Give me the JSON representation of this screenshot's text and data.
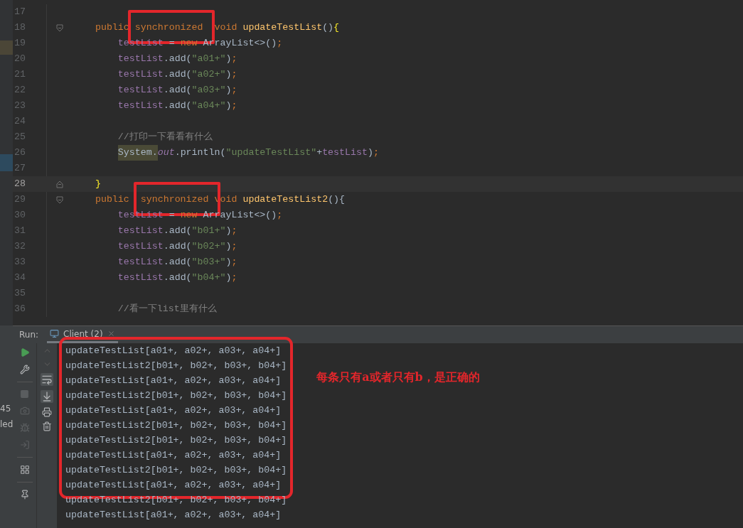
{
  "editor": {
    "lines": [
      {
        "number": "17",
        "kind": "plain",
        "current": false
      },
      {
        "number": "18",
        "kind": "fold-start",
        "current": false,
        "tokens": [
          {
            "kind": "keyword",
            "text": "    public "
          },
          {
            "kind": "keyword",
            "text": "synchronized",
            "boxed": true
          },
          {
            "kind": "keyword",
            "text": "  void "
          },
          {
            "kind": "method",
            "text": "updateTestList"
          },
          {
            "kind": "plain",
            "text": "()"
          },
          {
            "kind": "brace",
            "text": "{"
          }
        ]
      },
      {
        "number": "19",
        "kind": "plain",
        "current": false,
        "tokens": [
          {
            "kind": "field",
            "text": "        testList"
          },
          {
            "kind": "plain",
            "text": " = "
          },
          {
            "kind": "keyword",
            "text": "new "
          },
          {
            "kind": "plain",
            "text": "ArrayList<>()"
          },
          {
            "kind": "keyword",
            "text": ";"
          }
        ]
      },
      {
        "number": "20",
        "kind": "plain",
        "current": false,
        "tokens": [
          {
            "kind": "field",
            "text": "        testList"
          },
          {
            "kind": "plain",
            "text": ".add("
          },
          {
            "kind": "string",
            "text": "\"a01+\""
          },
          {
            "kind": "plain",
            "text": ")"
          },
          {
            "kind": "keyword",
            "text": ";"
          }
        ]
      },
      {
        "number": "21",
        "kind": "plain",
        "current": false,
        "tokens": [
          {
            "kind": "field",
            "text": "        testList"
          },
          {
            "kind": "plain",
            "text": ".add("
          },
          {
            "kind": "string",
            "text": "\"a02+\""
          },
          {
            "kind": "plain",
            "text": ")"
          },
          {
            "kind": "keyword",
            "text": ";"
          }
        ]
      },
      {
        "number": "22",
        "kind": "plain",
        "current": false,
        "tokens": [
          {
            "kind": "field",
            "text": "        testList"
          },
          {
            "kind": "plain",
            "text": ".add("
          },
          {
            "kind": "string",
            "text": "\"a03+\""
          },
          {
            "kind": "plain",
            "text": ")"
          },
          {
            "kind": "keyword",
            "text": ";"
          }
        ]
      },
      {
        "number": "23",
        "kind": "plain",
        "current": false,
        "tokens": [
          {
            "kind": "field",
            "text": "        testList"
          },
          {
            "kind": "plain",
            "text": ".add("
          },
          {
            "kind": "string",
            "text": "\"a04+\""
          },
          {
            "kind": "plain",
            "text": ")"
          },
          {
            "kind": "keyword",
            "text": ";"
          }
        ]
      },
      {
        "number": "24",
        "kind": "plain",
        "current": false
      },
      {
        "number": "25",
        "kind": "plain",
        "current": false,
        "tokens": [
          {
            "kind": "comment",
            "text": "        //打印一下看看有什么"
          }
        ]
      },
      {
        "number": "26",
        "kind": "plain",
        "current": false,
        "tokens": [
          {
            "kind": "marked",
            "text": "        System."
          },
          {
            "kind": "static",
            "text": "out"
          },
          {
            "kind": "plain",
            "text": ".println("
          },
          {
            "kind": "string",
            "text": "\"updateTestList\""
          },
          {
            "kind": "plain",
            "text": "+"
          },
          {
            "kind": "field",
            "text": "testList"
          },
          {
            "kind": "plain",
            "text": ")"
          },
          {
            "kind": "keyword",
            "text": ";"
          }
        ]
      },
      {
        "number": "27",
        "kind": "plain",
        "current": false
      },
      {
        "number": "28",
        "kind": "fold-end",
        "current": true,
        "tokens": [
          {
            "kind": "brace",
            "text": "    }"
          }
        ]
      },
      {
        "number": "29",
        "kind": "fold-start",
        "current": false,
        "tokens": [
          {
            "kind": "keyword",
            "text": "    public  "
          },
          {
            "kind": "keyword",
            "text": "synchronized",
            "boxed": true
          },
          {
            "kind": "keyword",
            "text": " void "
          },
          {
            "kind": "method",
            "text": "updateTestList2"
          },
          {
            "kind": "plain",
            "text": "(){"
          }
        ]
      },
      {
        "number": "30",
        "kind": "plain",
        "current": false,
        "tokens": [
          {
            "kind": "field",
            "text": "        testList"
          },
          {
            "kind": "plain",
            "text": " = "
          },
          {
            "kind": "keyword",
            "text": "new "
          },
          {
            "kind": "plain",
            "text": "ArrayList<>()"
          },
          {
            "kind": "keyword",
            "text": ";"
          }
        ]
      },
      {
        "number": "31",
        "kind": "plain",
        "current": false,
        "tokens": [
          {
            "kind": "field",
            "text": "        testList"
          },
          {
            "kind": "plain",
            "text": ".add("
          },
          {
            "kind": "string",
            "text": "\"b01+\""
          },
          {
            "kind": "plain",
            "text": ")"
          },
          {
            "kind": "keyword",
            "text": ";"
          }
        ]
      },
      {
        "number": "32",
        "kind": "plain",
        "current": false,
        "tokens": [
          {
            "kind": "field",
            "text": "        testList"
          },
          {
            "kind": "plain",
            "text": ".add("
          },
          {
            "kind": "string",
            "text": "\"b02+\""
          },
          {
            "kind": "plain",
            "text": ")"
          },
          {
            "kind": "keyword",
            "text": ";"
          }
        ]
      },
      {
        "number": "33",
        "kind": "plain",
        "current": false,
        "tokens": [
          {
            "kind": "field",
            "text": "        testList"
          },
          {
            "kind": "plain",
            "text": ".add("
          },
          {
            "kind": "string",
            "text": "\"b03+\""
          },
          {
            "kind": "plain",
            "text": ")"
          },
          {
            "kind": "keyword",
            "text": ";"
          }
        ]
      },
      {
        "number": "34",
        "kind": "plain",
        "current": false,
        "tokens": [
          {
            "kind": "field",
            "text": "        testList"
          },
          {
            "kind": "plain",
            "text": ".add("
          },
          {
            "kind": "string",
            "text": "\"b04+\""
          },
          {
            "kind": "plain",
            "text": ")"
          },
          {
            "kind": "keyword",
            "text": ";"
          }
        ]
      },
      {
        "number": "35",
        "kind": "plain",
        "current": false
      },
      {
        "number": "36",
        "kind": "plain",
        "current": false,
        "tokens": [
          {
            "kind": "comment",
            "text": "        //看一下list里有什么"
          }
        ]
      }
    ]
  },
  "side_fragments": [
    "45",
    "led"
  ],
  "run_panel": {
    "label": "Run:",
    "tab": {
      "title": "Client (2)",
      "selected": true
    },
    "output": [
      {
        "text": "updateTestList[a01+, a02+, a03+, a04+]",
        "boxed": true
      },
      {
        "text": "updateTestList2[b01+, b02+, b03+, b04+]",
        "boxed": true
      },
      {
        "text": "updateTestList[a01+, a02+, a03+, a04+]",
        "boxed": true
      },
      {
        "text": "updateTestList2[b01+, b02+, b03+, b04+]",
        "boxed": true
      },
      {
        "text": "updateTestList[a01+, a02+, a03+, a04+]",
        "boxed": true
      },
      {
        "text": "updateTestList2[b01+, b02+, b03+, b04+]",
        "boxed": true
      },
      {
        "text": "updateTestList2[b01+, b02+, b03+, b04+]",
        "boxed": true
      },
      {
        "text": "updateTestList[a01+, a02+, a03+, a04+]",
        "boxed": true
      },
      {
        "text": "updateTestList2[b01+, b02+, b03+, b04+]",
        "boxed": true
      },
      {
        "text": "updateTestList[a01+, a02+, a03+, a04+]",
        "boxed": true
      },
      {
        "text": "updateTestList2[b01+, b02+, b03+, b04+]",
        "boxed": false
      },
      {
        "text": "updateTestList[a01+, a02+, a03+, a04+]",
        "boxed": false
      }
    ],
    "note": "每条只有**a**或者只有**b**，是正确的"
  }
}
